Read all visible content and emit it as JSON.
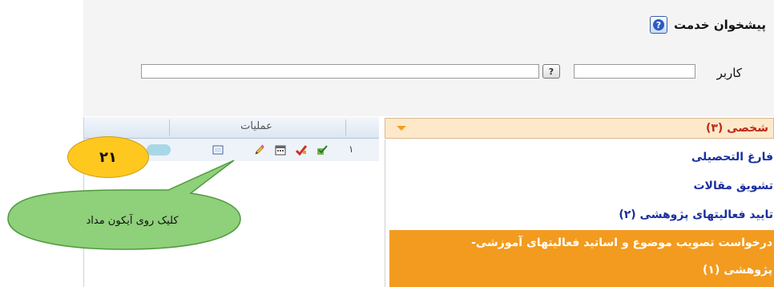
{
  "header": {
    "title": "پیشخوان خدمت",
    "help_icon": "help-icon"
  },
  "filter": {
    "user_label": "کاربر",
    "lookup_label": "?"
  },
  "grid": {
    "operations_header": "عملیات",
    "row_number": "۱"
  },
  "category": {
    "label": "شخصی (۳)"
  },
  "list": {
    "items": [
      "فارغ التحصیلی",
      "تشویق مقالات",
      "تایید فعالیتهای پژوهشی (۲)"
    ],
    "highlighted_line1": "درخواست تصویب موضوع و اساتید فعالیتهای آموزشی-",
    "highlighted_line2": "پژوهشی (۱)"
  },
  "annotation": {
    "step_number": "۲۱",
    "callout_text": "کلیک روی آیکون مداد"
  },
  "colors": {
    "highlight": "#f29b1f",
    "step_badge": "#ffc81f",
    "callout": "#8fd07a",
    "link": "#1a2f9e"
  }
}
